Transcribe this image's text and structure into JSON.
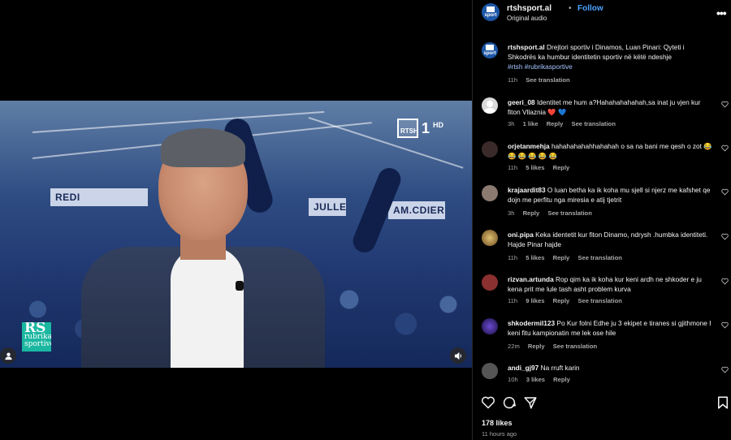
{
  "video": {
    "channel_logo_text": "RTSH",
    "channel_number": "1",
    "channel_hd": "HD",
    "show_logo_mark": "RS",
    "show_logo_text": "rubrika sportive",
    "backdrop_banners": [
      "REDI",
      "JULLE",
      "AM.CDIERO"
    ],
    "icons": {
      "user_tag": "person-icon",
      "sound": "speaker-icon"
    }
  },
  "post": {
    "username": "rtshsport.al",
    "dot": "•",
    "follow_label": "Follow",
    "audio_label": "Original audio",
    "avatar_text": "sport",
    "brand_color": "#1c56a6",
    "more_icon": "•••"
  },
  "caption": {
    "username": "rtshsport.al",
    "text": "Drejtori sportiv i Dinamos, Luan Pinari: Qyteti i Shkodrës ka humbur identitetin sportiv në këtë ndeshje",
    "hashtags": "#rtsh #rubrikasportive",
    "time": "11h",
    "see_translation": "See translation"
  },
  "comments": [
    {
      "username": "geeri_08",
      "text": "Identitet me hum a?Hahahahahahah,sa inat ju vjen kur fiton Vllaznia",
      "emoji": "❤️ 💙",
      "time": "3h",
      "likes": "1 like",
      "reply": "Reply",
      "translation": "See translation",
      "avatar_color": "#d9d9d9"
    },
    {
      "username": "orjetanmehja",
      "text": "hahahahahahhahahah o sa na bani me qesh o zot",
      "emoji": "😂 😂 😂 😂 😂 😂",
      "time": "11h",
      "likes": "5 likes",
      "reply": "Reply",
      "translation": "",
      "avatar_color": "#3a2a2a"
    },
    {
      "username": "krajaardit83",
      "text": "O luan betha ka ik koha mu sjell si njerz me kafshet qe dojn me perfitu nga miresia e atij tjetrit",
      "emoji": "",
      "time": "3h",
      "likes": "",
      "reply": "Reply",
      "translation": "See translation",
      "avatar_color": "#8a7a70"
    },
    {
      "username": "oni.pipa",
      "text": "Keka identetit kur fiton Dinamo, ndrysh .humbka identiteti. Hajde Pinar hajde",
      "emoji": "",
      "time": "11h",
      "likes": "5 likes",
      "reply": "Reply",
      "translation": "See translation",
      "avatar_color": "#c9a24a"
    },
    {
      "username": "rizvan.artunda",
      "text": "Rop qim ka ik koha kur keni ardh ne shkoder e ju kena prit me lule tash asht problem kurva",
      "emoji": "",
      "time": "11h",
      "likes": "9 likes",
      "reply": "Reply",
      "translation": "See translation",
      "avatar_color": "#8a3030"
    },
    {
      "username": "shkodermil123",
      "text": "Po Kur folni Edhe ju 3 ekipet e tiranes si gjithmone I keni fitu kampionatin me lek ose hile",
      "emoji": "",
      "time": "22m",
      "likes": "",
      "reply": "Reply",
      "translation": "See translation",
      "avatar_color": "#3a2a6a"
    },
    {
      "username": "andi_gj97",
      "text": "Na rruft karin",
      "emoji": "",
      "time": "10h",
      "likes": "3 likes",
      "reply": "Reply",
      "translation": "",
      "avatar_color": "#555555"
    }
  ],
  "actions": {
    "like_icon": "heart-icon",
    "comment_icon": "comment-icon",
    "share_icon": "send-icon",
    "save_icon": "bookmark-icon"
  },
  "footer": {
    "likes": "178 likes",
    "time_ago": "11 hours ago"
  }
}
